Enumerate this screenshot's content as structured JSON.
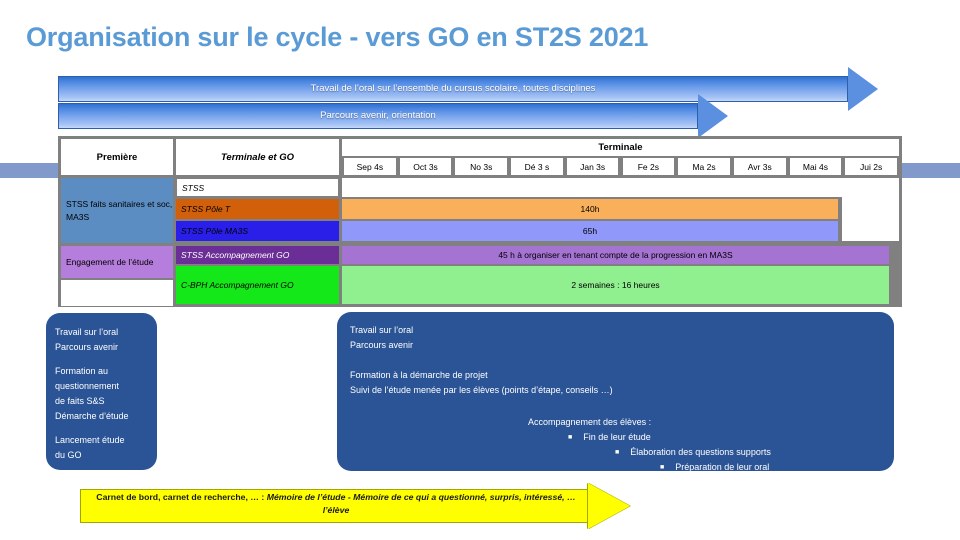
{
  "title": "Organisation sur le cycle - vers GO en ST2S 2021",
  "accent_color": "#5B9BD5",
  "arrows": [
    {
      "label": "Travail de l’oral sur l’ensemble du cursus scolaire, toutes disciplines"
    },
    {
      "label": "Parcours avenir, orientation"
    }
  ],
  "table": {
    "headers": {
      "premiere": "Première",
      "terminale_et_go": "Terminale et GO",
      "terminale": "Terminale"
    },
    "months": [
      "Sep 4s",
      "Oct 3s",
      "No 3s",
      "Dé 3 s",
      "Jan 3s",
      "Fe 2s",
      "Ma 2s",
      "Avr 3s",
      "Mai 4s",
      "Jui 2s"
    ],
    "groups": [
      {
        "label": "STSS faits sanitaires et soc, MA3S",
        "color": "#5B8DC2"
      },
      {
        "label": "Engagement de l’étude",
        "color": "#B57EDC"
      },
      {
        "label": "",
        "color": "#FFFFFF"
      }
    ],
    "rows": [
      {
        "name": "STSS",
        "name_color": "#FFFFFF",
        "name_text": "#000000",
        "bar_color": "#FFFFFF",
        "value": ""
      },
      {
        "name": "STSS Pôle T",
        "name_color": "#D2600A",
        "name_text": "#000000",
        "bar_color": "#FAB05A",
        "value": "140h"
      },
      {
        "name": "STSS Pôle MA3S",
        "name_color": "#2A1FE8",
        "name_text": "#000000",
        "bar_color": "#9098FA",
        "value": "65h"
      },
      {
        "name": "STSS Accompagnement GO",
        "name_color": "#6B2D96",
        "name_text": "#FFFFFF",
        "bar_color": "#A573D2",
        "value": "45 h à organiser en tenant compte de la progression en MA3S"
      },
      {
        "name": "C-BPH Accompagnement GO",
        "name_color": "#14E818",
        "name_text": "#000000",
        "bar_color": "#90F090",
        "value": "2 semaines : 16 heures"
      }
    ]
  },
  "box_left": {
    "lines": [
      "Travail sur l’oral",
      "Parcours avenir",
      "",
      "Formation au",
      "questionnement",
      "de faits S&S",
      "Démarche d’étude",
      "",
      "Lancement étude",
      "du GO"
    ]
  },
  "box_right": {
    "l1": "Travail sur l’oral",
    "l2": "Parcours avenir",
    "l3": "Formation à la démarche de projet",
    "l4": "Suivi de l’étude menée par les élèves  (points d’étape, conseils …)",
    "l5": "Accompagnement  des élèves :",
    "b1": "Fin de leur étude",
    "b2": "Élaboration des questions supports",
    "b3": "Préparation de leur oral"
  },
  "yellow_arrow": {
    "bold_part": "Carnet de bord, carnet de recherche, … : ",
    "italic_part": "Mémoire de l’étude - Mémoire de ce qui a questionné, surpris, intéressé, … l’élève",
    "fill": "#FFFF00"
  }
}
